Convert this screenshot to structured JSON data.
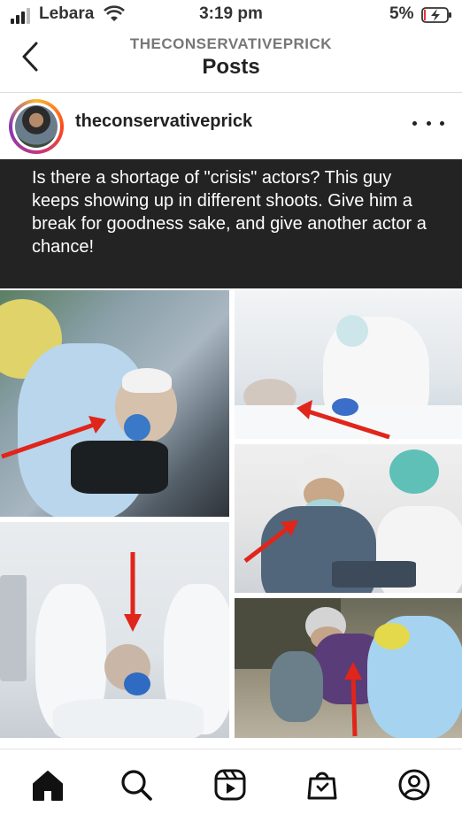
{
  "status_bar": {
    "carrier": "Lebara",
    "time": "3:19 pm",
    "battery": "5%"
  },
  "nav": {
    "account": "THECONSERVATIVEPRICK",
    "title": "Posts"
  },
  "post": {
    "username": "theconservativeprick",
    "caption": "Is there a shortage of \"crisis\" actors? This guy keeps showing up in different shoots. Give him a break for goodness sake, and give another actor a chance!"
  },
  "icons": {
    "back": "chevron-left-icon",
    "more": "more-options-icon",
    "home": "home-icon",
    "search": "search-icon",
    "reels": "reels-icon",
    "shop": "shop-icon",
    "profile": "profile-icon"
  },
  "colors": {
    "caption_bg": "#232323",
    "arrow": "#e0251b",
    "text": "#222222"
  }
}
